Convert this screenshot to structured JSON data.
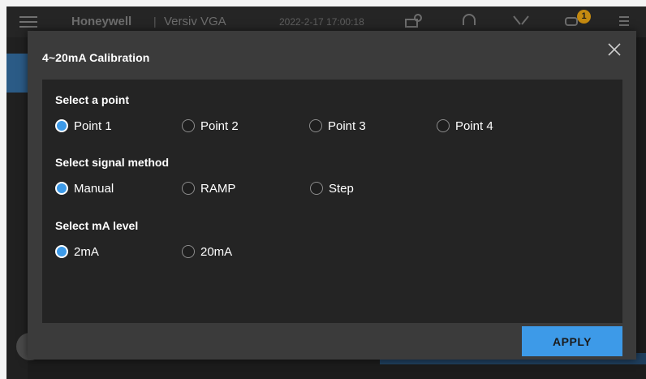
{
  "background": {
    "brand": "Honeywell",
    "separator": "|",
    "product": "Versiv VGA",
    "datetime": "2022-2-17 17:00:18",
    "badge_count": "1"
  },
  "modal": {
    "title": "4~20mA Calibration",
    "apply_label": "APPLY",
    "sections": {
      "point": {
        "label": "Select a point",
        "options": [
          "Point 1",
          "Point 2",
          "Point 3",
          "Point 4"
        ],
        "selected": "Point 1"
      },
      "signal": {
        "label": "Select signal method",
        "options": [
          "Manual",
          "RAMP",
          "Step"
        ],
        "selected": "Manual"
      },
      "level": {
        "label": "Select mA level",
        "options": [
          "2mA",
          "20mA"
        ],
        "selected": "2mA"
      }
    }
  },
  "colors": {
    "accent": "#3d9ae8",
    "modal_bg": "#3b3b3b",
    "panel_bg": "#242424",
    "badge": "#c58a10"
  }
}
